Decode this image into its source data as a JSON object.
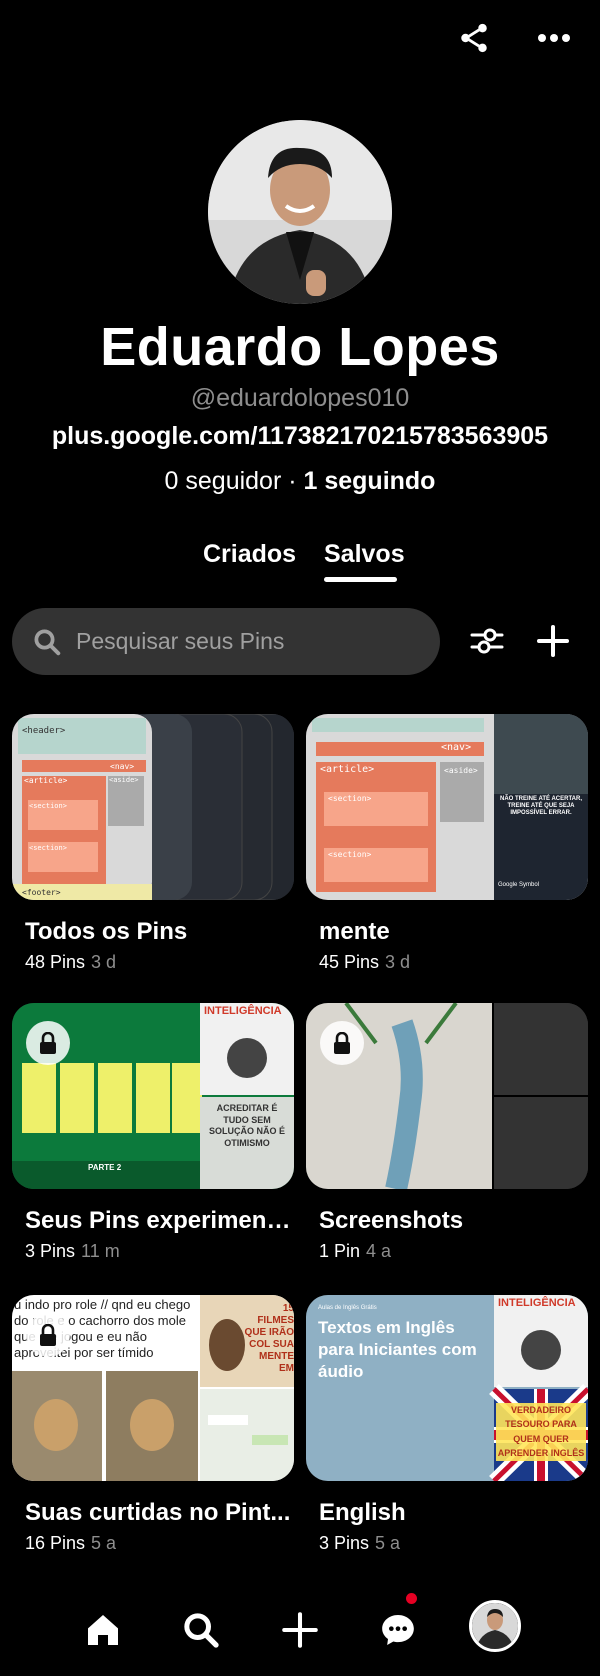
{
  "profile": {
    "name": "Eduardo Lopes",
    "handle": "@eduardolopes010",
    "website": "plus.google.com/117382170215783563905",
    "followers": "0 seguidor",
    "separator": " · ",
    "following": "1 seguindo"
  },
  "tabs": [
    {
      "label": "Criados",
      "selected": false
    },
    {
      "label": "Salvos",
      "selected": true
    }
  ],
  "search": {
    "placeholder": "Pesquisar seus Pins"
  },
  "boards": [
    {
      "title": "Todos os Pins",
      "count": "48 Pins",
      "time": "3 d",
      "secret": false,
      "cover_text": [
        "<header>",
        "<nav>",
        "<article>",
        "<aside>",
        "<section>",
        "<section>",
        "<footer>"
      ]
    },
    {
      "title": "mente",
      "count": "45 Pins",
      "time": "3 d",
      "secret": false,
      "cover_text": [
        "<nav>",
        "<article>",
        "<aside>",
        "<section>",
        "<section>",
        "NÃO TREINE ATÉ ACERTAR, TREINE ATÉ QUE SEJA IMPOSSÍVEL ERRAR.",
        "Google Symbol"
      ]
    },
    {
      "title": "Seus Pins experiment...",
      "count": "3 Pins",
      "time": "11 m",
      "secret": true,
      "cover_text": [
        "INTELIGÊNCIA",
        "PARTE 2",
        "ACREDITAR É TUDO SEM SOLUÇÃO NÃO É OTIMISMO"
      ]
    },
    {
      "title": "Screenshots",
      "count": "1 Pin",
      "time": "4 a",
      "secret": true,
      "cover_text": []
    },
    {
      "title": "Suas curtidas no Pint...",
      "count": "16 Pins",
      "time": "5 a",
      "secret": true,
      "cover_text": [
        "u indo pro role // qnd eu chego do role e o cachorro dos mole que me jogou e eu não aproveitei por ser tímido",
        "15 FILMES QUE IRÃO COL SUA MENTE EM"
      ]
    },
    {
      "title": "English",
      "count": "3 Pins",
      "time": "5 a",
      "secret": false,
      "cover_text": [
        "Aulas de Inglês Grátis",
        "Textos em Inglês para Iniciantes com áudio",
        "INTELIGÊNCIA",
        "VERDADEIRO TESOURO PARA QUEM QUER APRENDER INGLÊS"
      ]
    }
  ],
  "colors": {
    "background": "#000000",
    "search_bg": "#333333",
    "muted": "#8e8e8e",
    "notification": "#e60023"
  },
  "icons": {
    "share": "share-icon",
    "more": "more-icon",
    "search": "search-icon",
    "filter": "filter-icon",
    "add": "plus-icon",
    "lock": "lock-icon",
    "home": "home-icon",
    "nav_search": "search-icon",
    "create": "plus-icon",
    "messages": "chat-icon"
  }
}
